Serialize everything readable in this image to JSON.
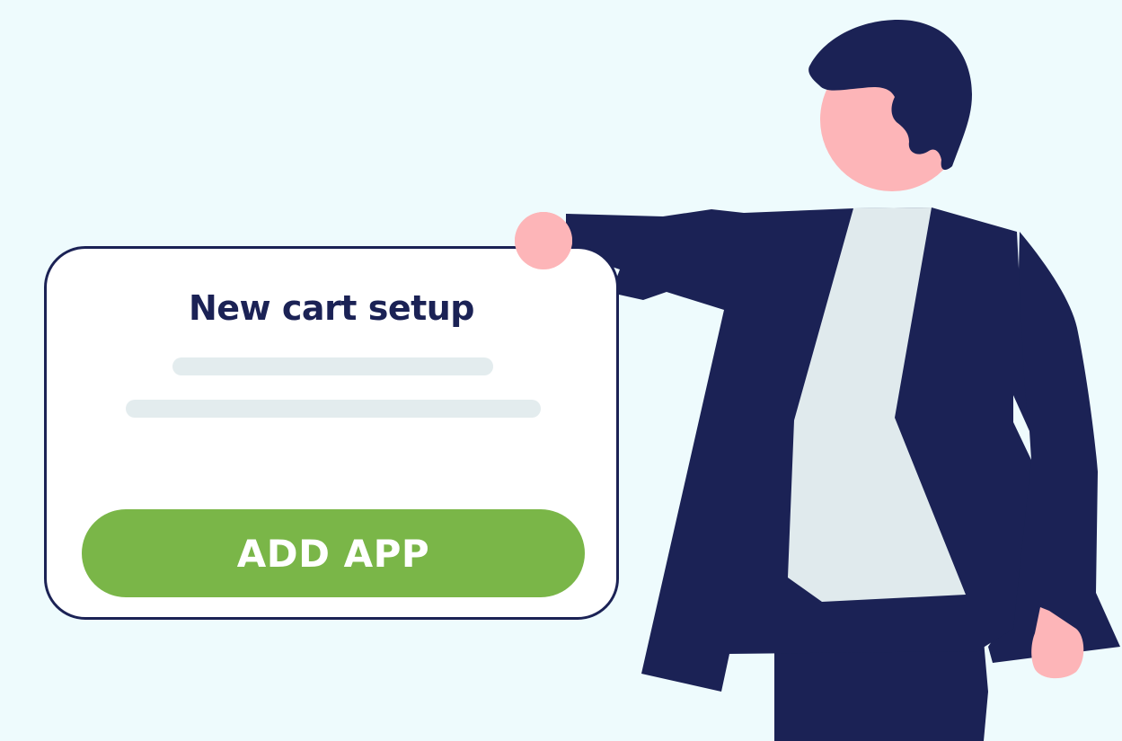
{
  "card": {
    "title": "New cart setup",
    "button_label": "ADD APP"
  },
  "colors": {
    "background": "#eefbfd",
    "navy": "#1b2255",
    "skin": "#fdb5b8",
    "shirt": "#e0eaed",
    "button_green": "#7ab648",
    "placeholder": "#e3ecee"
  },
  "icons": {
    "figure": "businessman-illustration"
  }
}
